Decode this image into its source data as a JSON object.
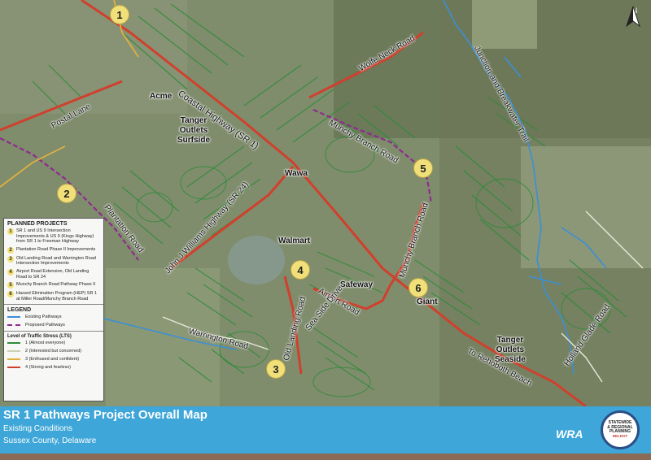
{
  "banner": {
    "title": "SR 1 Pathways Project Overall Map",
    "subtitle_line1": "Existing Conditions",
    "subtitle_line2": "Sussex County, Delaware",
    "logo_text": "WRA",
    "seal_line1": "STATEWIDE",
    "seal_line2": "& REGIONAL",
    "seal_line3": "PLANNING",
    "seal_line4": "DELDOT"
  },
  "north_arrow": {
    "label": "N"
  },
  "place_labels": [
    {
      "id": "acme",
      "text": "Acme"
    },
    {
      "id": "tanger-surfside",
      "text": "Tanger\nOutlets\nSurfside"
    },
    {
      "id": "wawa",
      "text": "Wawa"
    },
    {
      "id": "walmart",
      "text": "Walmart"
    },
    {
      "id": "safeway",
      "text": "Safeway"
    },
    {
      "id": "giant",
      "text": "Giant"
    },
    {
      "id": "tanger-seaside",
      "text": "Tanger\nOutlets\nSeaside"
    }
  ],
  "road_labels": [
    {
      "id": "postal-lane",
      "text": "Postal Lane"
    },
    {
      "id": "coastal-highway",
      "text": "Coastal Highway (SR 1)"
    },
    {
      "id": "wolfe-neck-road",
      "text": "Wolfe Neck Road"
    },
    {
      "id": "junction-breakwater",
      "text": "Junction and Breakwater Trail"
    },
    {
      "id": "munchy-branch-road-1",
      "text": "Munchy Branch Road"
    },
    {
      "id": "munchy-branch-road-2",
      "text": "Munchy Branch Road"
    },
    {
      "id": "plantation-road",
      "text": "Plantation Road"
    },
    {
      "id": "john-j-williams",
      "text": "John J Williams Highway (SR 24)"
    },
    {
      "id": "airport-road",
      "text": "Airport Road"
    },
    {
      "id": "sea-side-drive",
      "text": "Sea Side Drive"
    },
    {
      "id": "old-landing-road",
      "text": "Old Landing Road"
    },
    {
      "id": "warrington-road",
      "text": "Warrington Road"
    },
    {
      "id": "to-rehoboth-beach",
      "text": "To Rehoboth Beach"
    },
    {
      "id": "holland-glade-road",
      "text": "Holland Glade Road"
    }
  ],
  "project_markers": [
    "1",
    "2",
    "3",
    "4",
    "5",
    "6"
  ],
  "legend": {
    "planned_heading": "PLANNED PROJECTS",
    "planned_projects": [
      {
        "num": "1",
        "text": "SR 1 and US 9 Intersection Improvements & US 9 (Kings Highway) from SR 1 to Freeman Highway"
      },
      {
        "num": "2",
        "text": "Plantation Road Phase II Improvements"
      },
      {
        "num": "3",
        "text": "Old Landing Road and Warrington Road Intersection Improvements"
      },
      {
        "num": "4",
        "text": "Airport Road Extension, Old Landing Road to SR 24"
      },
      {
        "num": "5",
        "text": "Munchy Branch Road Pathway Phase II"
      },
      {
        "num": "6",
        "text": "Hazard Elimination Program (HEP) SR 1 at Miller Road/Munchy Branch Road"
      }
    ],
    "legend_heading": "LEGEND",
    "pathways": [
      {
        "text": "Existing Pathways",
        "color": "#3b8fd6",
        "style": "solid"
      },
      {
        "text": "Proposed Pathways",
        "color": "#8e2b8e",
        "style": "dashed"
      }
    ],
    "lts_heading": "Level of Traffic Stress (LTS)",
    "lts": [
      {
        "text": "1 (Almost everyone)",
        "color": "#2e8b3a"
      },
      {
        "text": "2 (Interested but concerned)",
        "color": "#d9d9c0"
      },
      {
        "text": "3 (Enthused and confident)",
        "color": "#e0b040"
      },
      {
        "text": "4 (Strong and fearless)",
        "color": "#d0402d"
      }
    ]
  },
  "colors": {
    "banner": "#3ea6d8",
    "lts4_road": "#d0402d",
    "lts1_road": "#2e8b3a",
    "existing_pathway": "#3b8fd6",
    "proposed_pathway": "#8e2b8e",
    "marker": "#f1e07a"
  }
}
